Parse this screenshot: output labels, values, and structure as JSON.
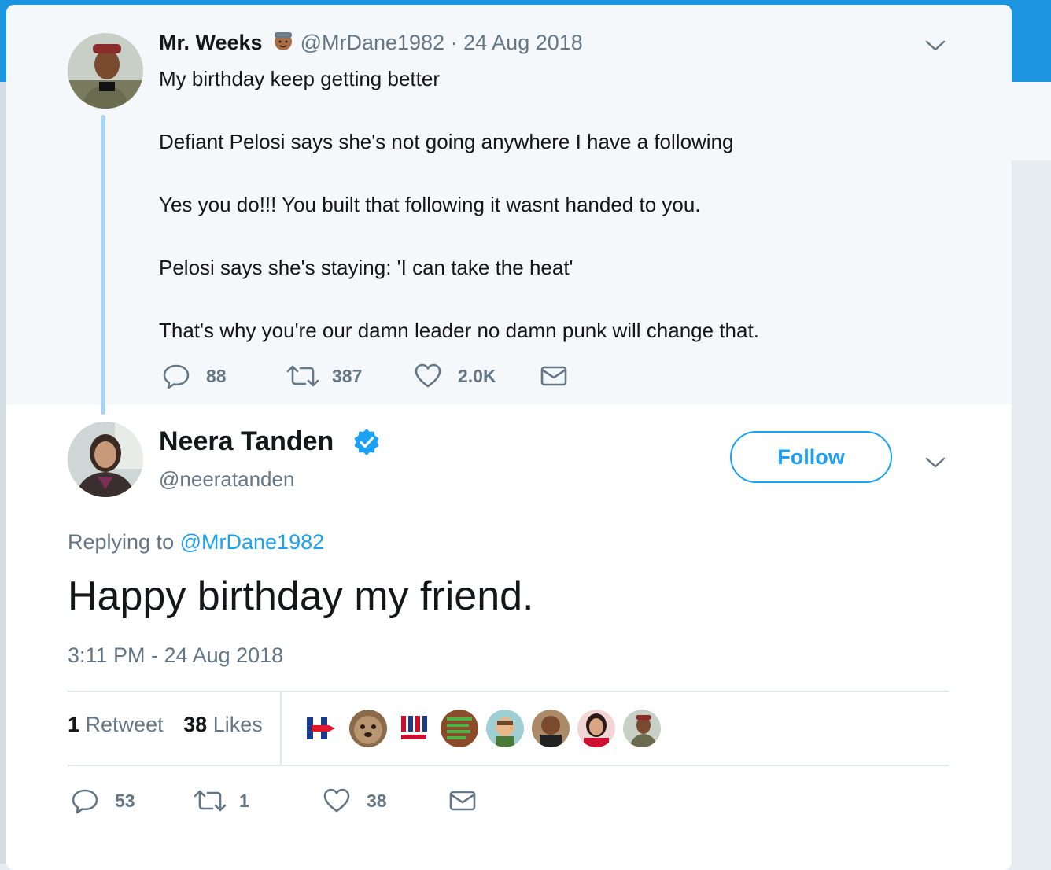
{
  "parent_tweet": {
    "name": "Mr. Weeks",
    "emoji_icon": "man-emoji-icon",
    "handle": "@MrDane1982",
    "separator": "·",
    "date": "24 Aug 2018",
    "lines": [
      "My birthday keep getting better",
      "",
      "Defiant Pelosi says she's not going anywhere I have a following",
      "",
      "Yes you do!!! You built that following it wasnt handed to you.",
      "",
      "Pelosi says she's staying: 'I can take the heat'",
      "",
      "That's why you're our damn leader no damn punk will change that."
    ],
    "actions": {
      "replies": "88",
      "retweets": "387",
      "likes": "2.0K"
    }
  },
  "main_tweet": {
    "name": "Neera Tanden",
    "handle": "@neeratanden",
    "follow_label": "Follow",
    "replying_prefix": "Replying to",
    "replying_to": "@MrDane1982",
    "text": "Happy birthday my friend.",
    "timestamp": "3:11 PM - 24 Aug 2018",
    "retweet_count": "1",
    "retweet_label": "Retweet",
    "like_count": "38",
    "like_label": "Likes",
    "actions": {
      "replies": "53",
      "retweets": "1",
      "likes": "38"
    }
  },
  "colors": {
    "accent": "#1da1f2",
    "text_primary": "#14171a",
    "text_secondary": "#657786",
    "thread_line": "#a9d4f2",
    "parent_bg": "#f5f8fa"
  }
}
